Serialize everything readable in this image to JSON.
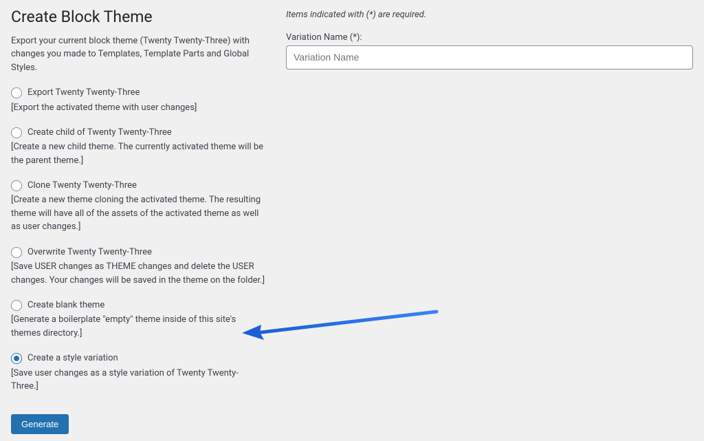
{
  "page": {
    "title": "Create Block Theme",
    "intro": "Export your current block theme (Twenty Twenty-Three) with changes you made to Templates, Template Parts and Global Styles."
  },
  "options": [
    {
      "label": "Export Twenty Twenty-Three",
      "description": "[Export the activated theme with user changes]",
      "checked": false
    },
    {
      "label": "Create child of Twenty Twenty-Three",
      "description": "[Create a new child theme. The currently activated theme will be the parent theme.]",
      "checked": false
    },
    {
      "label": "Clone Twenty Twenty-Three",
      "description": "[Create a new theme cloning the activated theme. The resulting theme will have all of the assets of the activated theme as well as user changes.]",
      "checked": false
    },
    {
      "label": "Overwrite Twenty Twenty-Three",
      "description": "[Save USER changes as THEME changes and delete the USER changes. Your changes will be saved in the theme on the folder.]",
      "checked": false
    },
    {
      "label": "Create blank theme",
      "description": "[Generate a boilerplate \"empty\" theme inside of this site's themes directory.]",
      "checked": false
    },
    {
      "label": "Create a style variation",
      "description": "[Save user changes as a style variation of Twenty Twenty-Three.]",
      "checked": true
    }
  ],
  "rightPanel": {
    "requiredNote": "Items indicated with (*) are required.",
    "fieldLabel": "Variation Name (*):",
    "placeholder": "Variation Name",
    "value": ""
  },
  "buttons": {
    "generate": "Generate"
  }
}
